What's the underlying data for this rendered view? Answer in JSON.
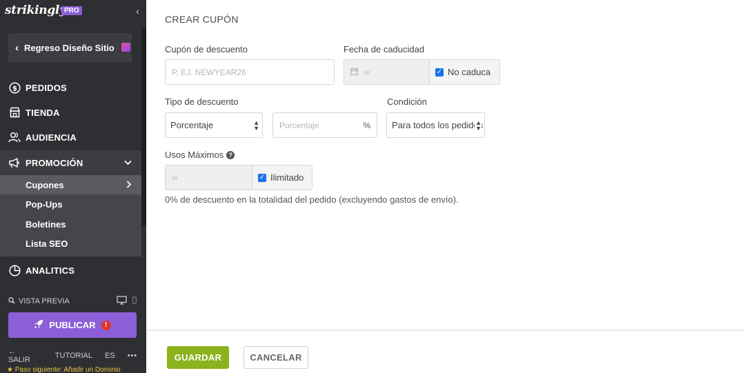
{
  "sidebar": {
    "logo": "strikingly",
    "pro_badge": "PRO",
    "back_label": "Regreso Diseño Sitio",
    "nav": {
      "pedidos": "PEDIDOS",
      "tienda": "TIENDA",
      "audiencia": "AUDIENCIA",
      "promocion": "PROMOCIÓN",
      "analiticas": "ANALITICS"
    },
    "sub_items": {
      "cupones": "Cupones",
      "popups": "Pop-Ups",
      "boletines": "Boletines",
      "lista_seo": "Lista SEO"
    },
    "preview_label": "VISTA PREVIA",
    "publish_label": "PUBLICAR",
    "publish_alert": "!",
    "footer": {
      "exit": "SALIR",
      "tutorial": "TUTORIAL",
      "language": "ES",
      "more": "•••"
    },
    "next_step": "★ Paso siguiente: Añadir un Dominio"
  },
  "main": {
    "heading": "CREAR CUPÓN",
    "coupon_label": "Cupón de descuento",
    "coupon_placeholder": "P. EJ. NEWYEAR26",
    "expiry_label": "Fecha de caducidad",
    "expiry_value": "∞",
    "no_expire_label": "No caduca",
    "discount_type_label": "Tipo de descuento",
    "discount_type_value": "Porcentaje",
    "percent_placeholder": "Porcentaje",
    "percent_unit": "%",
    "condition_label": "Condición",
    "condition_value": "Para todos los pedidos",
    "max_uses_label": "Usos Máximos",
    "max_uses_value": "∞",
    "unlimited_label": "Ilimitado",
    "summary": "0% de descuento en la totalidad del pedido (excluyendo gastos de envío)."
  },
  "actions": {
    "save": "GUARDAR",
    "cancel": "CANCELAR"
  },
  "colors": {
    "sidebar_bg": "#2e2f32",
    "accent_purple": "#8c5fd8",
    "save_green": "#8cb21d",
    "checkbox_blue": "#1a73e8"
  }
}
